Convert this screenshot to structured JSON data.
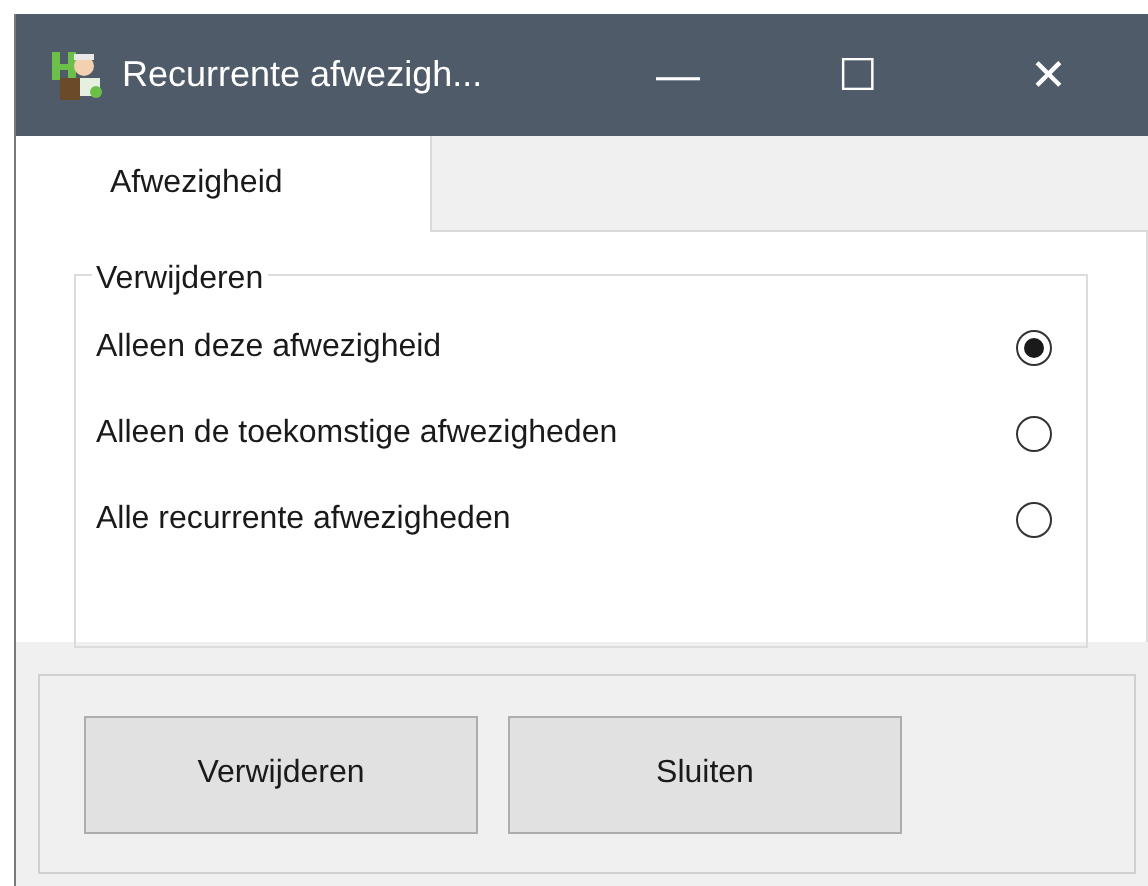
{
  "window": {
    "title": "Recurrente afwezigh...",
    "controls": [
      "—",
      "☐",
      "✕"
    ]
  },
  "tabs": [
    {
      "label": "Afwezigheid",
      "selected": true
    }
  ],
  "group": {
    "title": "Verwijderen",
    "options": [
      {
        "label": "Alleen deze afwezigheid",
        "selected": true
      },
      {
        "label": "Alleen de toekomstige afwezigheden",
        "selected": false
      },
      {
        "label": "Alle recurrente afwezigheden",
        "selected": false
      }
    ]
  },
  "buttons": [
    "Verwijderen",
    "Sluiten"
  ]
}
